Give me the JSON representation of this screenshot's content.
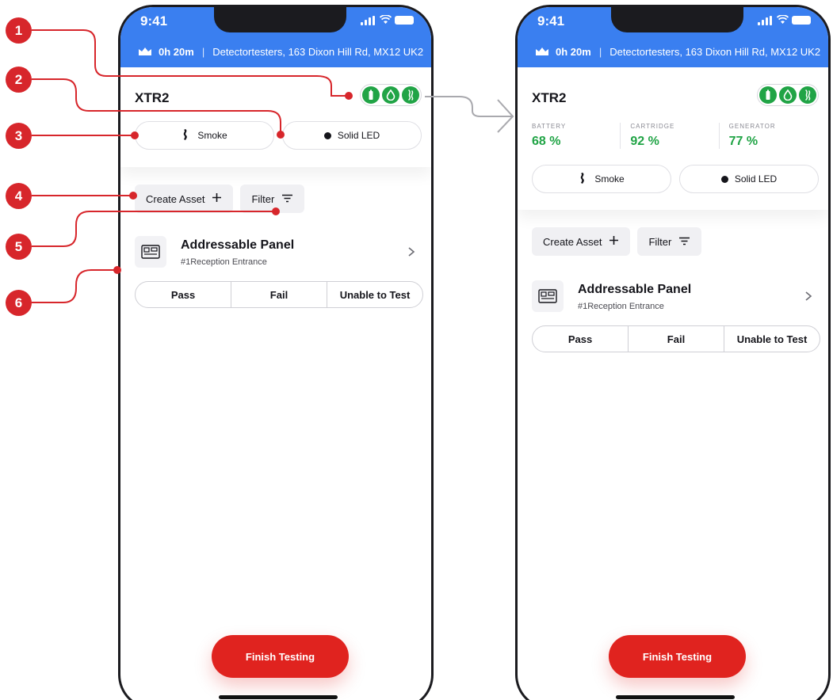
{
  "status_bar": {
    "time": "9:41"
  },
  "info_bar": {
    "duration": "0h 20m",
    "address": "Detectortesters, 163 Dixon Hill Rd, MX12 UK2"
  },
  "device": {
    "name": "XTR2",
    "status_icons": [
      "battery-icon",
      "cartridge-drop-icon",
      "generator-flame-icon"
    ]
  },
  "stats": [
    {
      "label": "BATTERY",
      "value": "68 %"
    },
    {
      "label": "CARTRIDGE",
      "value": "92 %"
    },
    {
      "label": "GENERATOR",
      "value": "77 %"
    }
  ],
  "chips": {
    "type_label": "Smoke",
    "led_label": "Solid LED"
  },
  "actions": {
    "create_label": "Create Asset",
    "filter_label": "Filter"
  },
  "asset": {
    "title": "Addressable Panel",
    "subtitle": "#1Reception Entrance",
    "results": [
      "Pass",
      "Fail",
      "Unable to Test"
    ]
  },
  "finish_label": "Finish Testing",
  "callouts": [
    "1",
    "2",
    "3",
    "4",
    "5",
    "6"
  ],
  "colors": {
    "header_blue": "#3a7ff0",
    "status_green": "#21a446",
    "accent_red": "#e0231f",
    "callout_red": "#d7262b"
  }
}
